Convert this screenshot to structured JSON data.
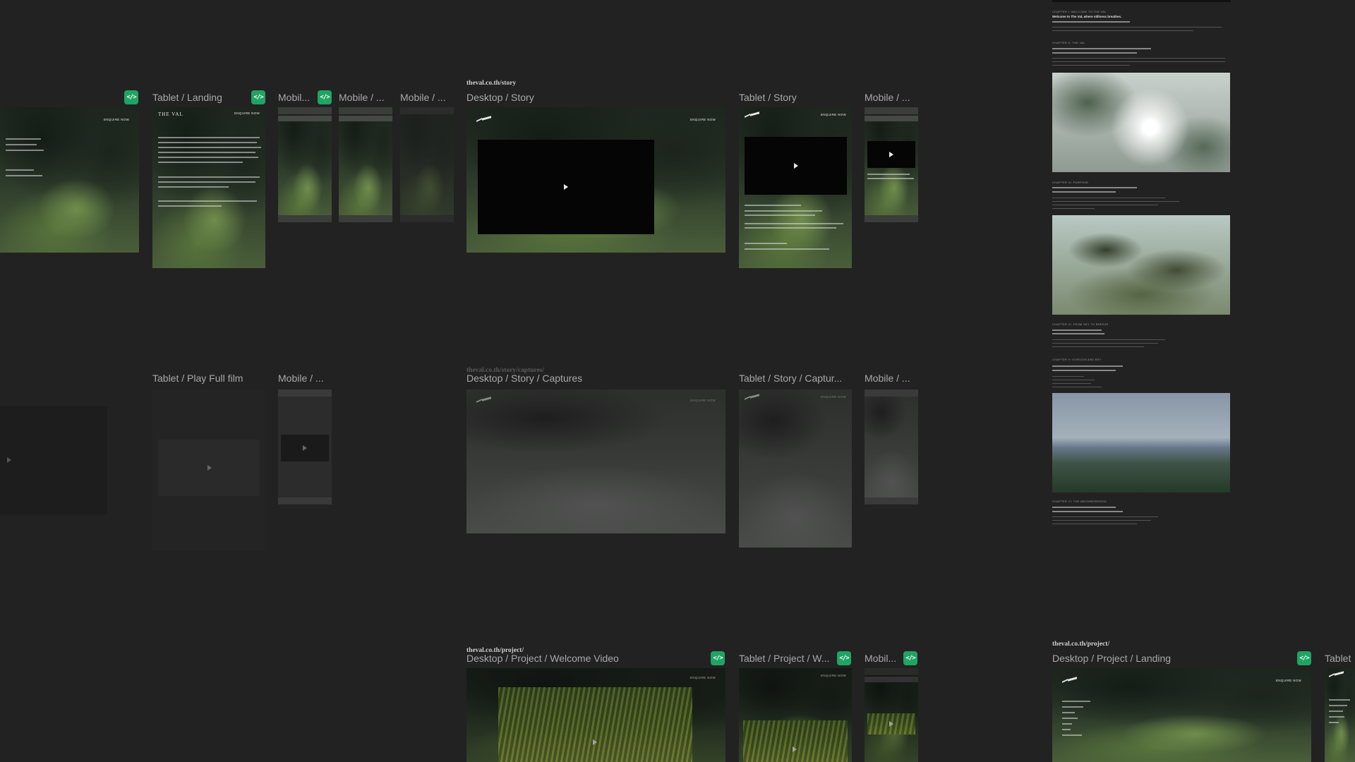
{
  "frames": {
    "tablet_landing": "Tablet / Landing",
    "mobile_1": "Mobil...",
    "mobile_2": "Mobile / ...",
    "mobile_3": "Mobile / ...",
    "desktop_story": "Desktop / Story",
    "tablet_story": "Tablet / Story",
    "mobile_story": "Mobile / ...",
    "tablet_play_full_film": "Tablet / Play Full film",
    "mobile_play": "Mobile / ...",
    "desktop_story_captures": "Desktop / Story / Captures",
    "tablet_story_captures": "Tablet / Story / Captur...",
    "mobile_captures": "Mobile / ...",
    "desktop_project_welcome": "Desktop / Project / Welcome Video",
    "tablet_project_welcome": "Tablet / Project / W...",
    "mobile_project": "Mobil...",
    "desktop_project_landing": "Desktop / Project / Landing",
    "tablet_edge": "Tablet"
  },
  "urls": {
    "story": "theval.co.th/story",
    "captures": "theval.co.th/story/captures/",
    "project_1": "theval.co.th/project/",
    "project_2": "theval.co.th/project/"
  },
  "badges": {
    "code": "</>"
  },
  "site": {
    "enquire": "ENQUIRE NOW",
    "brand": "THE VAL"
  },
  "document": {
    "chapter_1": "CHAPTER I: WELCOME TO THE VAL",
    "chapter_1_lead": "Welcome to The Val, where stillness breathes.",
    "chapter_2": "CHAPTER II: THE VAL",
    "chapter_3": "CHAPTER III: PURPOSE",
    "chapter_4": "CHAPTER IV: FROM SKY TO BREEZE",
    "chapter_5": "CHAPTER V: HORIZON AND BEY",
    "chapter_6": "CHAPTER VI: THE NEIGHBORHOOD"
  },
  "colors": {
    "canvas": "#222222",
    "badge": "#1fa463",
    "label": "#a8a8a8"
  }
}
